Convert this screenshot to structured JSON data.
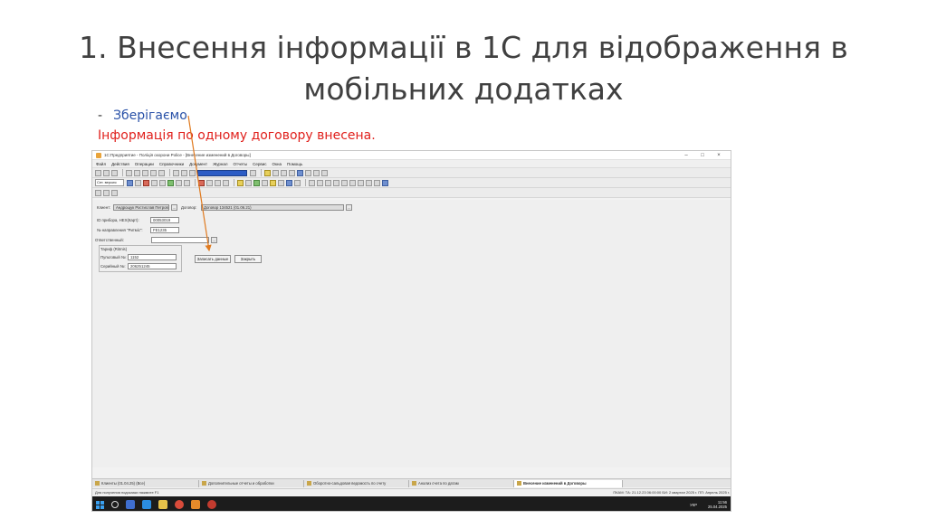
{
  "slide": {
    "title": "1. Внесення інформації в 1С для відображення в мобільних додатках",
    "bullet_dash": "-",
    "bullet": "Зберігаємо",
    "note": "Інформація по одному договору внесена."
  },
  "colors": {
    "bullet": "#2a52a8",
    "note": "#e0201c",
    "arrow": "#e07a1f"
  },
  "window": {
    "title": "1С:Предприятие - Поліція охорони Police - [Внесение изменений в Договоры]",
    "controls": [
      "–",
      "□",
      "×"
    ],
    "menu": [
      "Файл",
      "Действия",
      "Операции",
      "Справочники",
      "Документ",
      "Журнал",
      "Отчеты",
      "Сервис",
      "Окна",
      "Помощь"
    ],
    "search_label": "Сет. версия"
  },
  "form": {
    "client_label": "Клиент:",
    "client_value": "Андрощук Ростислав Петрович",
    "contract_label": "Договор:",
    "contract_value": "Договор 134521 (01.06.21)",
    "device_label": "ID прибора, HEX(Карт):",
    "device_value": "00053019",
    "direction_label": "№ направления \"Ритміс\":",
    "direction_value": "FE1235",
    "responsible_label": "Ответственный:",
    "responsible_value": "",
    "tariff_group_label": "Тариф (Ritmis)",
    "console_label": "Пультовый №:",
    "console_value": "1152",
    "serial_label": "Серийный №:",
    "serial_value": "206251245",
    "save_button": "Записать данные",
    "close_button": "Закрыть"
  },
  "window_tabs": [
    {
      "label": "Клиенты (01.04.25) (Все)",
      "active": false
    },
    {
      "label": "Дополнительные отчеты и обработки",
      "active": false
    },
    {
      "label": "Оборотно-сальдовая ведомость по счету",
      "active": false
    },
    {
      "label": "Анализ счета по датам",
      "active": false
    },
    {
      "label": "Внесение изменений в Договоры",
      "active": true
    }
  ],
  "status": {
    "hint": "Для получения подсказки нажмите F1",
    "right": "ПКАМ: ТА: 21.12.23 06:00:00     БИ: 2 квартал 2025 г.     ПП: Апрель 2025 г."
  },
  "taskbar": {
    "lang": "УКР",
    "time": "11:56",
    "date": "25.04.2025"
  }
}
